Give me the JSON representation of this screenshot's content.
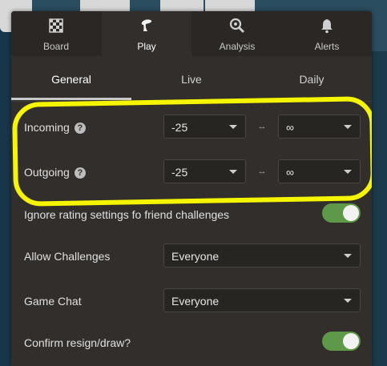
{
  "top_tabs": [
    {
      "label": "Board",
      "icon": "board-icon"
    },
    {
      "label": "Play",
      "icon": "pawn-icon"
    },
    {
      "label": "Analysis",
      "icon": "analysis-icon"
    },
    {
      "label": "Alerts",
      "icon": "bell-icon"
    }
  ],
  "active_top_tab": "Play",
  "sub_tabs": [
    "General",
    "Live",
    "Daily"
  ],
  "active_sub_tab": "General",
  "rating_range": {
    "incoming": {
      "label": "Incoming",
      "help": "?",
      "min": "-25",
      "max": "∞",
      "separator": "↔"
    },
    "outgoing": {
      "label": "Outgoing",
      "help": "?",
      "min": "-25",
      "max": "∞",
      "separator": "↔"
    }
  },
  "ignore_rating": {
    "label": "Ignore rating settings fo friend challenges",
    "enabled": true
  },
  "allow_challenges": {
    "label": "Allow Challenges",
    "value": "Everyone"
  },
  "game_chat": {
    "label": "Game Chat",
    "value": "Everyone"
  },
  "confirm_resign": {
    "label": "Confirm resign/draw?",
    "enabled": true
  },
  "colors": {
    "accent_green": "#5d9948",
    "highlight": "#f5f500",
    "panel": "#312e2b"
  }
}
